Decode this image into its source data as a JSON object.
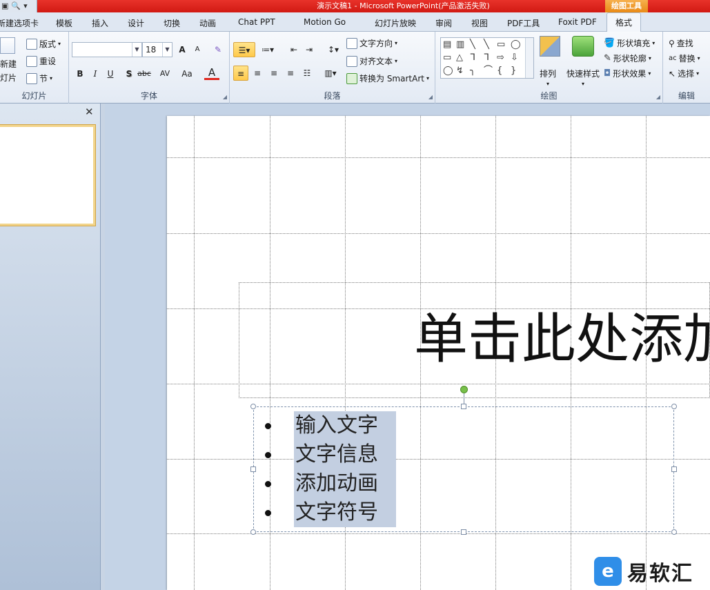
{
  "titlebar": {
    "qat_icons": [
      "save-icon",
      "print-preview-icon",
      "customize-icon"
    ],
    "qat_glyphs": [
      "▣",
      "🔍",
      "▾"
    ],
    "title": "演示文稿1 - Microsoft PowerPoint(产品激活失败)",
    "context_group": "绘图工具"
  },
  "tabs": [
    {
      "label": "新建选项卡"
    },
    {
      "label": "模板"
    },
    {
      "label": "插入"
    },
    {
      "label": "设计"
    },
    {
      "label": "切换"
    },
    {
      "label": "动画"
    },
    {
      "label": "Chat PPT"
    },
    {
      "label": "Motion Go"
    },
    {
      "label": "幻灯片放映"
    },
    {
      "label": "审阅"
    },
    {
      "label": "视图"
    },
    {
      "label": "PDF工具"
    },
    {
      "label": "Foxit PDF"
    },
    {
      "label": "格式"
    }
  ],
  "ribbon": {
    "slides": {
      "label": "幻灯片",
      "new_slide": "新建",
      "new_slide_sub": "灯片",
      "layout": "版式",
      "reset": "重设",
      "section": "节"
    },
    "font": {
      "label": "字体",
      "font_name": "",
      "font_size": "18",
      "grow": "A",
      "shrink": "A",
      "clear": "✎",
      "bold": "B",
      "italic": "I",
      "underline": "U",
      "shadow": "S",
      "strike": "abc",
      "spacing": "AV",
      "case": "Aa",
      "color": "A"
    },
    "paragraph": {
      "label": "段落",
      "text_direction": "文字方向",
      "align_text": "对齐文本",
      "smartart": "转换为 SmartArt"
    },
    "drawing": {
      "label": "绘图",
      "arrange": "排列",
      "quick_styles": "快速样式",
      "shape_fill": "形状填充",
      "shape_outline": "形状轮廓",
      "shape_effects": "形状效果",
      "shapes_row1": [
        "▤",
        "▥",
        "╲",
        "╲",
        "▭",
        "◯"
      ],
      "shapes_row2": [
        "▭",
        "△",
        "ᒣ",
        "ᒣ",
        "⇨",
        "⇩"
      ],
      "shapes_row3": [
        "◯",
        "↯",
        "╮",
        "⌒",
        "{",
        "}"
      ]
    },
    "editing": {
      "label": "编辑",
      "find": "查找",
      "replace": "替换",
      "select": "选择"
    }
  },
  "left_pane": {
    "close": "✕"
  },
  "slide": {
    "title_placeholder": "单击此处添加标题",
    "bullets": [
      "输入文字",
      "文字信息",
      "添加动画",
      "文字符号"
    ]
  },
  "watermark": {
    "logo": "e",
    "text": "易软汇"
  },
  "colors": {
    "title_bar": "#d11a13",
    "context_tab": "#e98a16",
    "selection_highlight": "#c3cfe1",
    "rotate_handle": "#78c04a"
  }
}
